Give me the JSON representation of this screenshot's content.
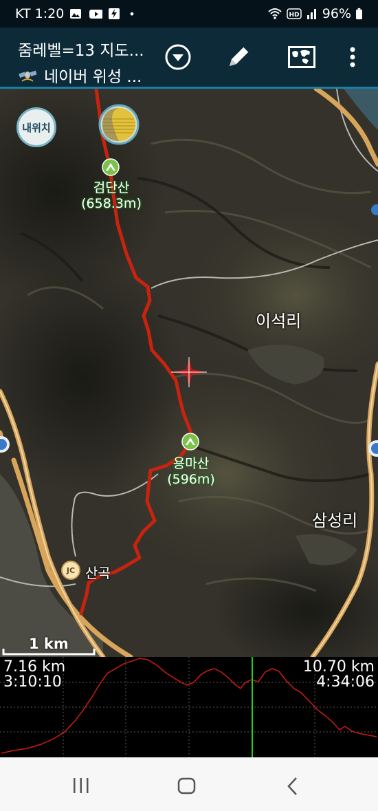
{
  "status_bar": {
    "carrier_time": "KT 1:20",
    "dot": "•",
    "battery": "96%",
    "icons": [
      "gallery-icon",
      "youtube-icon",
      "flash-icon",
      "wifi-icon",
      "hd-icon",
      "signal-icon",
      "battery-icon"
    ]
  },
  "header": {
    "title": "줌레벨=13 지도...",
    "subtitle": "네이버 위성 ...",
    "buttons": [
      "dropdown-icon",
      "pencil-icon",
      "map-layer-icon",
      "more-vert-icon"
    ]
  },
  "map": {
    "my_location_label": "내위치",
    "peaks": [
      {
        "name": "검단산",
        "elevation": "(658.3m)"
      },
      {
        "name": "용마산",
        "elevation": "(596m)"
      }
    ],
    "places": [
      "이석리",
      "삼성리"
    ],
    "junction": {
      "badge": "JC",
      "name": "산곡"
    },
    "scale_label": "1 km",
    "colors": {
      "track": "#c8230f",
      "peak_marker": "#7cc24a"
    }
  },
  "profile": {
    "left_distance": "7.16 km",
    "left_time": "3:10:10",
    "right_distance": "10.70 km",
    "right_time": "4:34:06",
    "colors": {
      "line": "#d21a14",
      "cursor": "#1fd01f"
    }
  },
  "nav_bar": {
    "buttons": [
      "recent-apps-icon",
      "home-icon",
      "back-icon"
    ]
  }
}
